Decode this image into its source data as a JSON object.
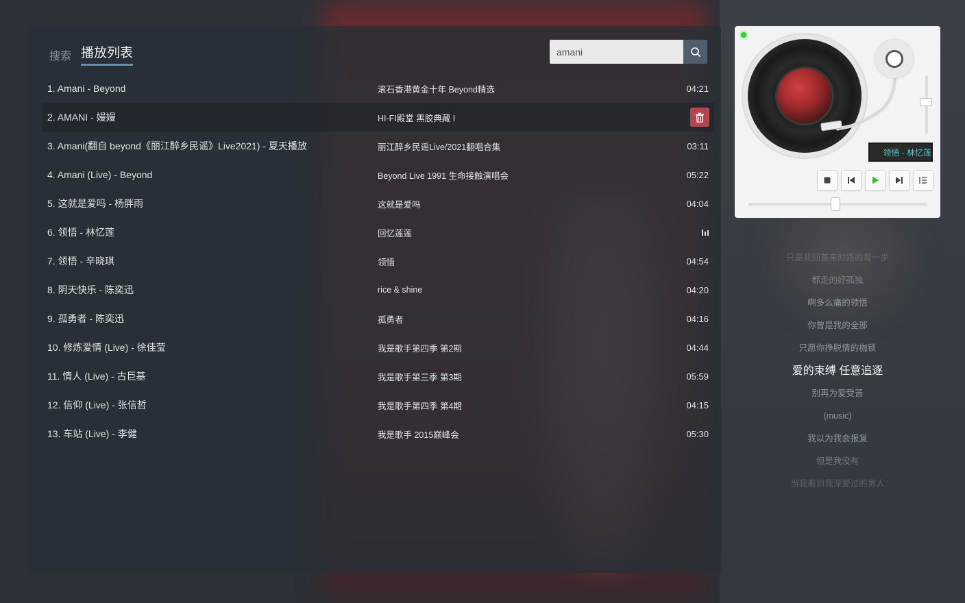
{
  "tabs": [
    {
      "label": "搜索"
    },
    {
      "label": "播放列表"
    }
  ],
  "search": {
    "value": "amani",
    "placeholder": ""
  },
  "playlist": [
    {
      "title": "1. Amani - Beyond",
      "album": "滚石香港黄金十年 Beyond精选",
      "duration": "04:21"
    },
    {
      "title": "2. AMANI - 嫚嫚",
      "album": "HI-FI殿堂 黑胶典藏 I",
      "duration": ""
    },
    {
      "title": "3. Amani(翻自 beyond《丽江醉乡民谣》Live2021) - 夏天播放",
      "album": "丽江醉乡民谣Live/2021翻唱合集",
      "duration": "03:11"
    },
    {
      "title": "4. Amani (Live) - Beyond",
      "album": "Beyond Live 1991 生命接触演唱会",
      "duration": "05:22"
    },
    {
      "title": "5. 这就是爱吗 - 杨胖雨",
      "album": "这就是爱吗",
      "duration": "04:04"
    },
    {
      "title": "6. 领悟 - 林忆莲",
      "album": "回忆莲莲",
      "duration": ""
    },
    {
      "title": "7. 领悟 - 辛晓琪",
      "album": "领悟",
      "duration": "04:54"
    },
    {
      "title": "8. 阴天快乐 - 陈奕迅",
      "album": "rice & shine",
      "duration": "04:20"
    },
    {
      "title": "9. 孤勇者 - 陈奕迅",
      "album": "孤勇者",
      "duration": "04:16"
    },
    {
      "title": "10. 修炼爱情 (Live) - 徐佳莹",
      "album": "我是歌手第四季 第2期",
      "duration": "04:44"
    },
    {
      "title": "11. 情人 (Live) - 古巨基",
      "album": "我是歌手第三季 第3期",
      "duration": "05:59"
    },
    {
      "title": "12. 信仰 (Live) - 张信哲",
      "album": "我是歌手第四季 第4期",
      "duration": "04:15"
    },
    {
      "title": "13. 车站 (Live) - 李健",
      "album": "我是歌手 2015巅峰会",
      "duration": "05:30"
    }
  ],
  "player": {
    "now_playing": "领悟 - 林忆莲",
    "volume": 0.55,
    "progress": 0.49
  },
  "lyrics": [
    {
      "text": "只是我回首来时路的每一步"
    },
    {
      "text": "都走的好孤独"
    },
    {
      "text": "啊多么痛的领悟"
    },
    {
      "text": "你曾是我的全部"
    },
    {
      "text": "只愿你挣脱情的枷锁"
    },
    {
      "text": "爱的束缚 任意追逐"
    },
    {
      "text": "别再为爱受苦"
    },
    {
      "text": "(music)"
    },
    {
      "text": "我以为我会报复"
    },
    {
      "text": "但是我没有"
    },
    {
      "text": "当我看到我深爱过的男人"
    }
  ],
  "colors": {
    "accent": "#6a8ea8",
    "delete": "#b1474d",
    "led": "#2fd22f",
    "lcd_text": "#4ec9c9"
  }
}
